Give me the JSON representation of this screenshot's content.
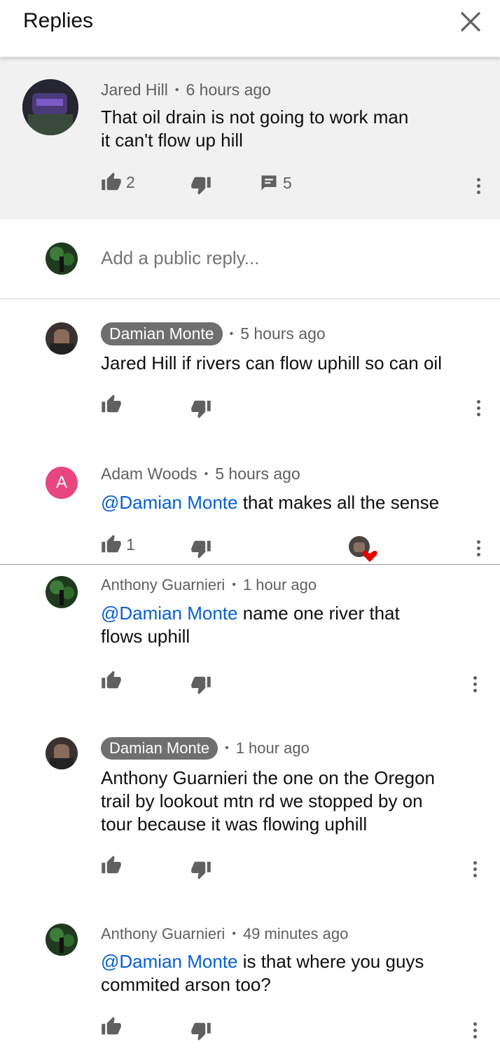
{
  "header": {
    "title": "Replies"
  },
  "parent": {
    "author": "Jared Hill",
    "time": "6 hours ago",
    "text_line1": "That oil drain is not going to work man",
    "text_line2": "it can't flow up hill",
    "likes": "2",
    "reply_count": "5"
  },
  "reply_box": {
    "placeholder": "Add a public reply..."
  },
  "replies": [
    {
      "author": "Damian Monte",
      "time": "5 hours ago",
      "text": "Jared Hill if rivers can flow uphill so can oil"
    },
    {
      "author": "Adam Woods",
      "avatar_letter": "A",
      "time": "5 hours ago",
      "mention": "@Damian Monte",
      "text": " that makes all the sense",
      "likes": "1"
    },
    {
      "author": "Anthony Guarnieri",
      "time": "1 hour ago",
      "mention": "@Damian Monte",
      "text_line1": " name one river that",
      "text_line2": "flows uphill"
    },
    {
      "author": "Damian Monte",
      "time": "1 hour ago",
      "text_line1": "Anthony Guarnieri the one on the Oregon",
      "text_line2": "trail by lookout mtn rd we stopped by on",
      "text_line3": "tour because it was flowing uphill"
    },
    {
      "author": "Anthony Guarnieri",
      "time": "49 minutes ago",
      "mention": "@Damian Monte",
      "text_line1": " is that where you guys",
      "text_line2": "commited arson too?"
    }
  ],
  "colors": {
    "accent_link": "#065fd4",
    "heart": "#e00000",
    "avatar_a": "#e8467e",
    "parent_bg": "#f1f1f1"
  },
  "icons": [
    "close-icon",
    "like-icon",
    "dislike-icon",
    "reply-icon",
    "more-icon",
    "heart-icon"
  ]
}
